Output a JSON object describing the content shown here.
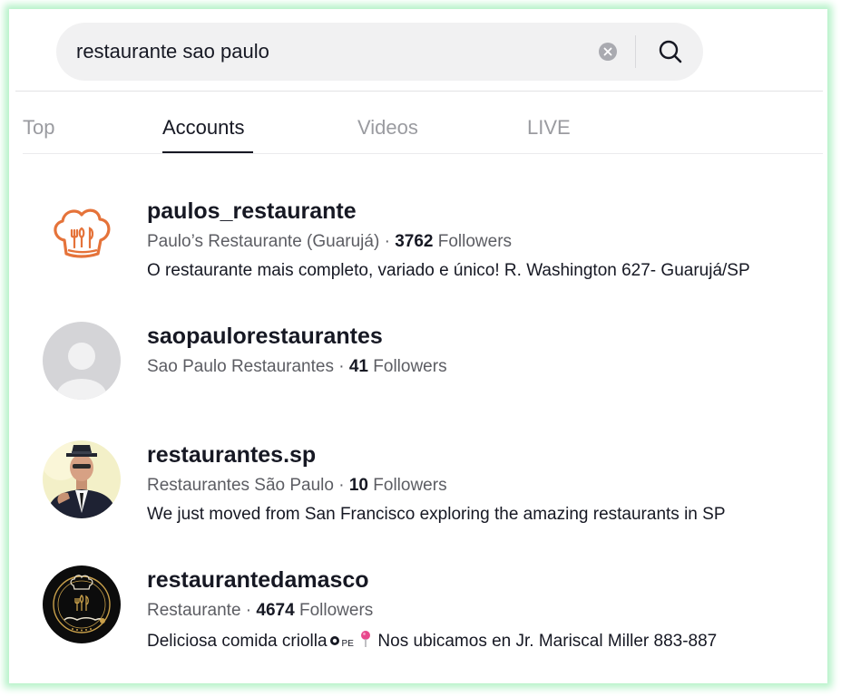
{
  "search": {
    "query": "restaurante sao paulo"
  },
  "tabs": [
    {
      "label": "Top",
      "active": false
    },
    {
      "label": "Accounts",
      "active": true
    },
    {
      "label": "Videos",
      "active": false
    },
    {
      "label": "LIVE",
      "active": false
    }
  ],
  "accounts": [
    {
      "username": "paulos_restaurante",
      "display_name": "Paulo’s Restaurante (Guarujá)",
      "followers": "3762",
      "followers_label": "Followers",
      "bio": "O restaurante mais completo, variado e único! R. Washington 627- Guarujá/SP",
      "avatar_icon": "chef-hat-logo-icon"
    },
    {
      "username": "saopaulorestaurantes",
      "display_name": "Sao Paulo Restaurantes",
      "followers": "41",
      "followers_label": "Followers",
      "bio": "",
      "avatar_icon": "default-avatar-icon"
    },
    {
      "username": "restaurantes.sp",
      "display_name": "Restaurantes São Paulo",
      "followers": "10",
      "followers_label": "Followers",
      "bio": "We just moved from San Francisco exploring the amazing restaurants in SP",
      "avatar_icon": "man-in-hat-photo"
    },
    {
      "username": "restaurantedamasco",
      "display_name": "Restaurante",
      "followers": "4674",
      "followers_label": "Followers",
      "bio_start": "Deliciosa comida criolla",
      "bio_emoji_text": "PE",
      "bio_end": " Nos ubicamos en Jr. Mariscal Miller 883-887",
      "avatar_icon": "el-damasco-logo-icon"
    }
  ],
  "separator": "·",
  "colors": {
    "text_primary": "#161823",
    "text_secondary": "#5c5d63",
    "tab_inactive": "#9a9ba0",
    "search_bg": "#f1f1f2",
    "logo_orange": "#e5733a",
    "frame_glow": "#b5f2c8"
  }
}
